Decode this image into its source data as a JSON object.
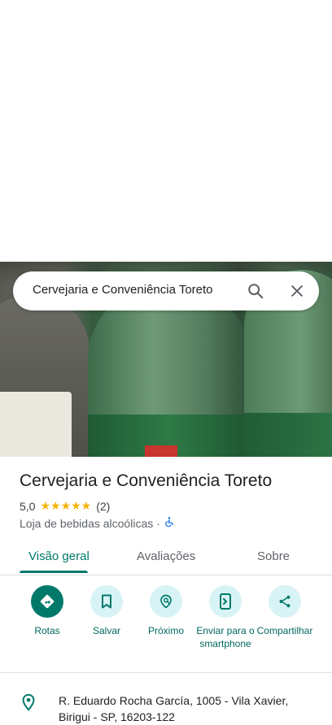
{
  "search": {
    "query": "Cervejaria e Conveniência Toreto"
  },
  "place": {
    "name": "Cervejaria e Conveniência Toreto",
    "rating": "5,0",
    "stars": "★★★★★",
    "reviews_count": "(2)",
    "category": "Loja de bebidas alcoólicas",
    "separator": "·"
  },
  "tabs": [
    {
      "label": "Visão geral",
      "active": true
    },
    {
      "label": "Avaliações",
      "active": false
    },
    {
      "label": "Sobre",
      "active": false
    }
  ],
  "actions": [
    {
      "label": "Rotas",
      "icon": "directions-icon"
    },
    {
      "label": "Salvar",
      "icon": "bookmark-icon"
    },
    {
      "label": "Próximo",
      "icon": "nearby-icon"
    },
    {
      "label": "Enviar para o smartphone",
      "icon": "send-to-phone-icon"
    },
    {
      "label": "Compartilhar",
      "icon": "share-icon"
    }
  ],
  "address": {
    "text": "R. Eduardo Rocha García, 1005 - Vila Xavier, Birigui - SP, 16203-122"
  },
  "colors": {
    "accent": "#00796b",
    "action_bg": "#d8f3f5",
    "star": "#f5b400"
  }
}
